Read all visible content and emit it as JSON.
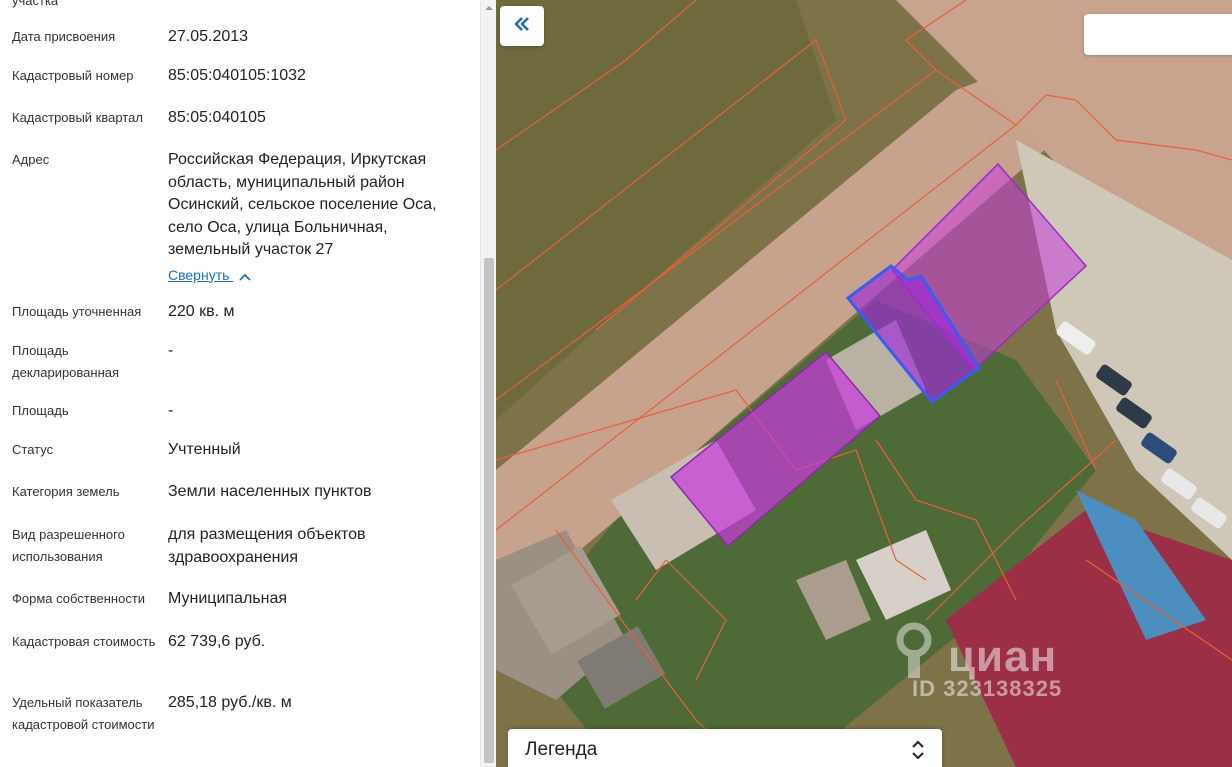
{
  "panel": {
    "cut_off_label": "участка",
    "fields": [
      {
        "label": "Дата присвоения",
        "value": "27.05.2013"
      },
      {
        "label": "Кадастровый номер",
        "value": "85:05:040105:1032"
      },
      {
        "label": "Кадастровый квартал",
        "value": "85:05:040105"
      },
      {
        "label": "Адрес",
        "value": "Российская Федерация, Иркутская область, муниципальный район Осинский, сельское поселение Оса, село Оса, улица Больничная, земельный участок 27"
      },
      {
        "label": "Площадь уточненная",
        "value": "220 кв. м"
      },
      {
        "label": "Площадь декларированная",
        "value": "-"
      },
      {
        "label": "Площадь",
        "value": "-"
      },
      {
        "label": "Статус",
        "value": "Учтенный"
      },
      {
        "label": "Категория земель",
        "value": "Земли населенных пунктов"
      },
      {
        "label": "Вид разрешенного использования",
        "value": "для размещения объектов здравоохранения"
      },
      {
        "label": "Форма собственности",
        "value": "Муниципальная"
      },
      {
        "label": "Кадастровая стоимость",
        "value": "62 739,6 руб."
      },
      {
        "label": "Удельный показатель кадастровой стоимости",
        "value": "285,18 руб./кв. м"
      }
    ],
    "collapse_link": "Свернуть"
  },
  "map": {
    "legend_label": "Легенда",
    "watermark_name": "циан",
    "watermark_id": "ID 323138325",
    "icons": {
      "collapse": "double-chevron-left-icon",
      "legend_toggle": "chevron-up-down-icon",
      "collapse_link": "chevron-up-icon"
    },
    "colors": {
      "parcel_border": "#e8603a",
      "building_fill": "#c03ad8",
      "selected_parcel_border": "#3a5cf0",
      "link": "#1d6fb8"
    }
  }
}
